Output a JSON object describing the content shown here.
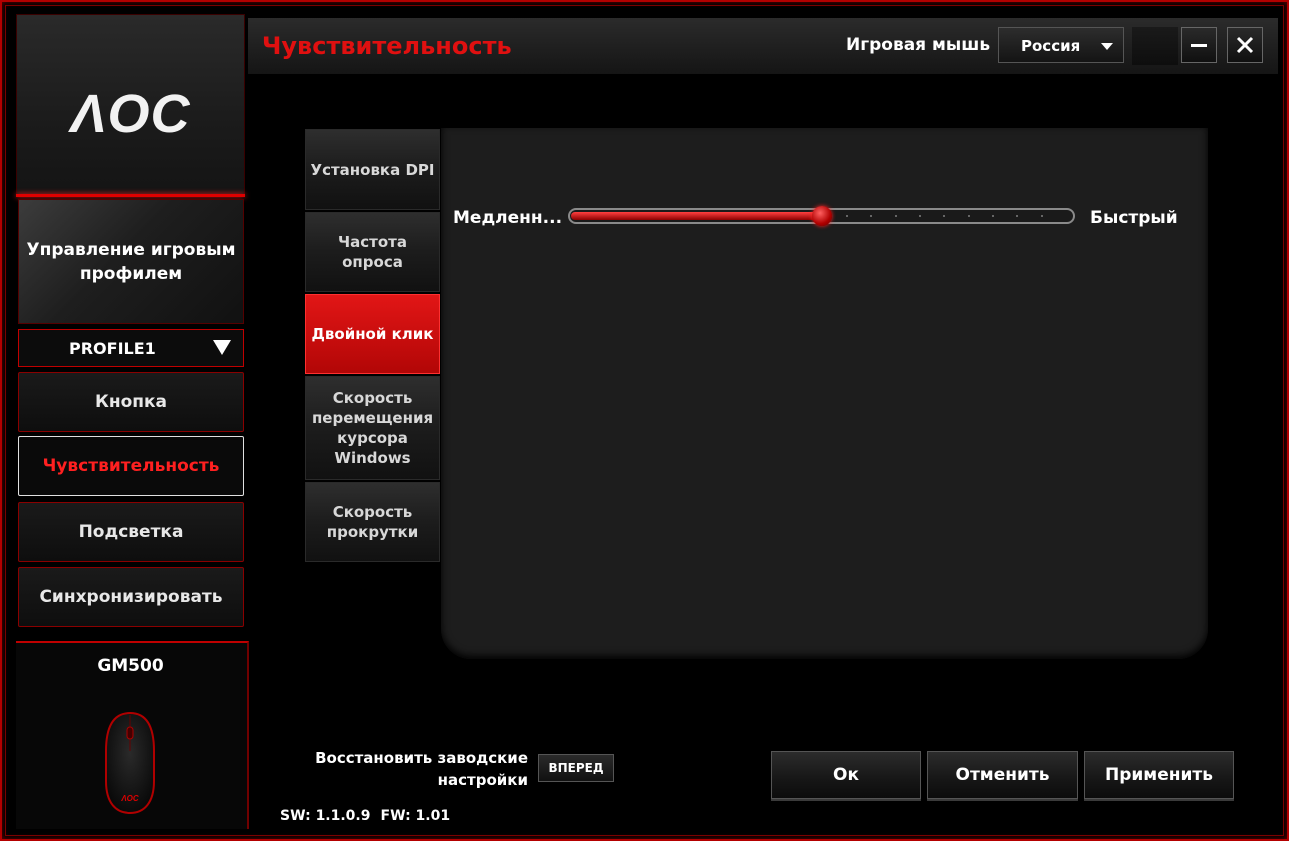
{
  "brand": {
    "logo_text": "ΛOC"
  },
  "sidebar": {
    "profile_management": "Управление игровым профилем",
    "profile_select": {
      "value": "PROFILE1"
    },
    "items": [
      {
        "label": "Кнопка",
        "active": false
      },
      {
        "label": "Чувствительность",
        "active": true
      },
      {
        "label": "Подсветка",
        "active": false
      },
      {
        "label": "Синхронизировать",
        "active": false
      }
    ],
    "device": {
      "name": "GM500",
      "mouse_logo": "ΛOC"
    }
  },
  "header": {
    "title": "Чувствительность",
    "mouse_label": "Игровая мышь",
    "language": "Россия"
  },
  "subtabs": [
    {
      "label": "Установка DPI",
      "active": false
    },
    {
      "label": "Частота опроса",
      "active": false
    },
    {
      "label": "Двойной клик",
      "active": true
    },
    {
      "label": "Скорость перемещения курсора Windows",
      "active": false
    },
    {
      "label": "Скорость прокрутки",
      "active": false
    }
  ],
  "slider": {
    "min_label": "Медленн...",
    "max_label": "Быстрый",
    "value_fraction": 0.5,
    "steps": 20
  },
  "footer": {
    "restore_label": "Восстановить заводские настройки",
    "restore_button": "ВПЕРЕД",
    "sw_version": "SW: 1.1.0.9",
    "fw_version": "FW: 1.01",
    "ok": "Ок",
    "cancel": "Отменить",
    "apply": "Применить"
  },
  "colors": {
    "accent": "#e01010",
    "border": "#b40000"
  },
  "icons": {
    "minimize": "minimize-icon",
    "close": "close-icon",
    "dropdown": "caret-down-icon"
  }
}
